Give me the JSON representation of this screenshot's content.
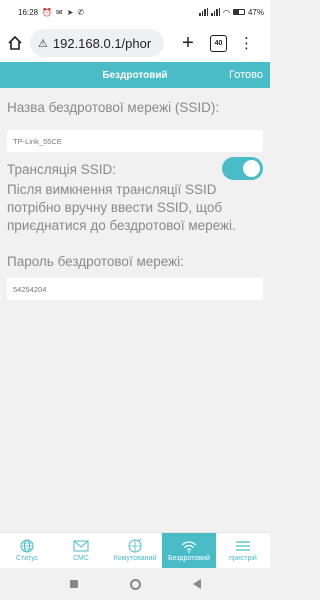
{
  "status_bar": {
    "time": "16:28",
    "battery": "47"
  },
  "browser": {
    "url": "192.168.0.1/phor",
    "tab_count": "40"
  },
  "header": {
    "title": "Бездротовий",
    "done_label": "Готово"
  },
  "form": {
    "ssid_label": "Назва бездротової мережі (SSID):",
    "ssid_value": "TP-Link_55CE",
    "broadcast_label": "Трансляція SSID:",
    "broadcast_enabled": true,
    "broadcast_help": "Після вимкнення трансляції SSID потрібно вручну ввести SSID, щоб приєднатися до бездротової мережі.",
    "password_label": "Пароль бездротової мережі:",
    "password_value": "54254204"
  },
  "bottom_nav": {
    "items": [
      {
        "label": "Статус",
        "icon": "globe-icon"
      },
      {
        "label": "СМС",
        "icon": "mail-icon"
      },
      {
        "label": "Комутований",
        "icon": "globe-network-icon"
      },
      {
        "label": "Бездротовий",
        "icon": "wifi-icon",
        "active": true
      },
      {
        "label": "пристрій",
        "icon": "menu-icon"
      }
    ]
  },
  "colors": {
    "accent": "#4abcc8",
    "background": "#f1f1f1"
  }
}
